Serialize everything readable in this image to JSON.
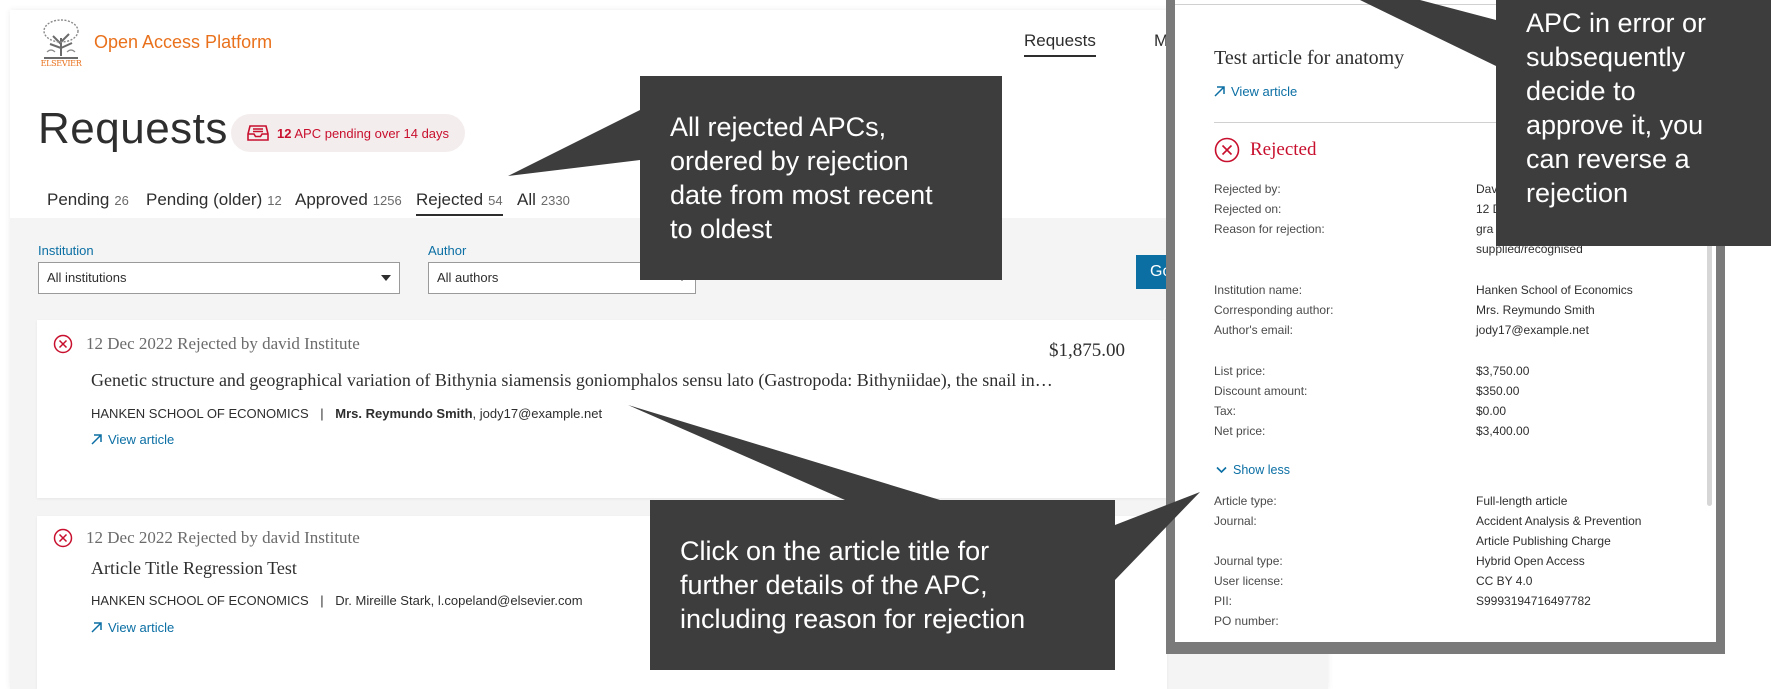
{
  "header": {
    "logo_text": "ELSEVIER",
    "brand": "Open Access Platform",
    "nav": [
      {
        "label": "Requests",
        "active": true
      },
      {
        "label": "M"
      }
    ]
  },
  "page": {
    "title": "Requests",
    "alert": {
      "count": "12",
      "text": "APC pending over 14 days"
    }
  },
  "tabs": [
    {
      "label": "Pending",
      "count": "26"
    },
    {
      "label": "Pending (older)",
      "count": "12"
    },
    {
      "label": "Approved",
      "count": "1256"
    },
    {
      "label": "Rejected",
      "count": "54",
      "active": true
    },
    {
      "label": "All",
      "count": "2330"
    }
  ],
  "filters": {
    "institution": {
      "label": "Institution",
      "value": "All institutions"
    },
    "author": {
      "label": "Author",
      "value": "All authors"
    },
    "go_label": "Go"
  },
  "cards": [
    {
      "status": "12 Dec 2022 Rejected by david Institute",
      "price": "$1,875.00",
      "title": "Genetic structure and geographical variation of Bithynia siamensis goniomphalos sensu lato (Gastropoda: Bithyniidae), the snail in…",
      "institution": "HANKEN SCHOOL OF ECONOMICS",
      "separator": "|",
      "author": "Mrs. Reymundo Smith",
      "email": ", jody17@example.net",
      "link": "View article"
    },
    {
      "status": "12 Dec 2022 Rejected by david Institute",
      "title": "Article Title Regression Test",
      "institution": "HANKEN SCHOOL OF ECONOMICS",
      "separator": "|",
      "author_email": "Dr. Mireille Stark, l.copeland@elsevier.com",
      "link": "View article"
    }
  ],
  "panel": {
    "title": "Test article for anatomy",
    "link": "View article",
    "status": "Rejected",
    "rejection": [
      {
        "k": "Rejected by:",
        "v": "Dav"
      },
      {
        "k": "Rejected on:",
        "v": "12 D"
      },
      {
        "k": "Reason for rejection:",
        "v": "gra"
      },
      {
        "k": "",
        "v": "supplied/recognised"
      }
    ],
    "details": [
      {
        "k": "Institution name:",
        "v": "Hanken School of Economics"
      },
      {
        "k": "Corresponding author:",
        "v": "Mrs. Reymundo Smith"
      },
      {
        "k": "Author's email:",
        "v": "jody17@example.net"
      }
    ],
    "pricing": [
      {
        "k": "List price:",
        "v": "$3,750.00"
      },
      {
        "k": "Discount amount:",
        "v": "$350.00"
      },
      {
        "k": "Tax:",
        "v": "$0.00"
      },
      {
        "k": "Net price:",
        "v": "$3,400.00"
      }
    ],
    "show_less": "Show less",
    "article": [
      {
        "k": "Article type:",
        "v": "Full-length article"
      },
      {
        "k": "Journal:",
        "v": "Accident Analysis & Prevention"
      },
      {
        "k": "",
        "v": "Article Publishing Charge"
      },
      {
        "k": "Journal type:",
        "v": "Hybrid Open Access"
      },
      {
        "k": "User license:",
        "v": "CC BY 4.0"
      },
      {
        "k": "PII:",
        "v": "S9993194716497782"
      },
      {
        "k": "PO number:",
        "v": ""
      }
    ]
  },
  "callouts": {
    "rejected_order": [
      "All rejected APCs,",
      "ordered by rejection",
      "date from most recent",
      "to oldest"
    ],
    "click_title": [
      "Click on the article title for",
      "further details of the APC,",
      "including reason for rejection"
    ],
    "reverse": [
      "APC in error or",
      "subsequently",
      "decide to",
      "approve it, you",
      "can reverse a",
      "rejection"
    ]
  },
  "colors": {
    "brand_orange": "#e9711c",
    "link_blue": "#0b6fa4",
    "reject_red": "#c8102e",
    "callout_bg": "#3d3d3d"
  }
}
